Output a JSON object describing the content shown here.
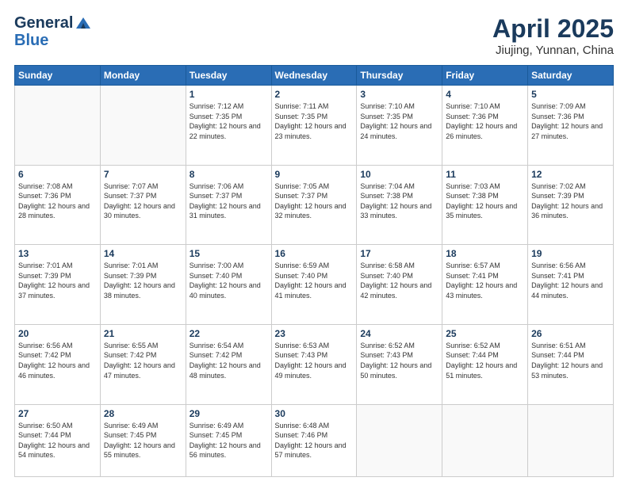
{
  "logo": {
    "general": "General",
    "blue": "Blue"
  },
  "header": {
    "month": "April 2025",
    "location": "Jiujing, Yunnan, China"
  },
  "weekdays": [
    "Sunday",
    "Monday",
    "Tuesday",
    "Wednesday",
    "Thursday",
    "Friday",
    "Saturday"
  ],
  "weeks": [
    [
      {
        "day": "",
        "info": ""
      },
      {
        "day": "",
        "info": ""
      },
      {
        "day": "1",
        "info": "Sunrise: 7:12 AM\nSunset: 7:35 PM\nDaylight: 12 hours and 22 minutes."
      },
      {
        "day": "2",
        "info": "Sunrise: 7:11 AM\nSunset: 7:35 PM\nDaylight: 12 hours and 23 minutes."
      },
      {
        "day": "3",
        "info": "Sunrise: 7:10 AM\nSunset: 7:35 PM\nDaylight: 12 hours and 24 minutes."
      },
      {
        "day": "4",
        "info": "Sunrise: 7:10 AM\nSunset: 7:36 PM\nDaylight: 12 hours and 26 minutes."
      },
      {
        "day": "5",
        "info": "Sunrise: 7:09 AM\nSunset: 7:36 PM\nDaylight: 12 hours and 27 minutes."
      }
    ],
    [
      {
        "day": "6",
        "info": "Sunrise: 7:08 AM\nSunset: 7:36 PM\nDaylight: 12 hours and 28 minutes."
      },
      {
        "day": "7",
        "info": "Sunrise: 7:07 AM\nSunset: 7:37 PM\nDaylight: 12 hours and 30 minutes."
      },
      {
        "day": "8",
        "info": "Sunrise: 7:06 AM\nSunset: 7:37 PM\nDaylight: 12 hours and 31 minutes."
      },
      {
        "day": "9",
        "info": "Sunrise: 7:05 AM\nSunset: 7:37 PM\nDaylight: 12 hours and 32 minutes."
      },
      {
        "day": "10",
        "info": "Sunrise: 7:04 AM\nSunset: 7:38 PM\nDaylight: 12 hours and 33 minutes."
      },
      {
        "day": "11",
        "info": "Sunrise: 7:03 AM\nSunset: 7:38 PM\nDaylight: 12 hours and 35 minutes."
      },
      {
        "day": "12",
        "info": "Sunrise: 7:02 AM\nSunset: 7:39 PM\nDaylight: 12 hours and 36 minutes."
      }
    ],
    [
      {
        "day": "13",
        "info": "Sunrise: 7:01 AM\nSunset: 7:39 PM\nDaylight: 12 hours and 37 minutes."
      },
      {
        "day": "14",
        "info": "Sunrise: 7:01 AM\nSunset: 7:39 PM\nDaylight: 12 hours and 38 minutes."
      },
      {
        "day": "15",
        "info": "Sunrise: 7:00 AM\nSunset: 7:40 PM\nDaylight: 12 hours and 40 minutes."
      },
      {
        "day": "16",
        "info": "Sunrise: 6:59 AM\nSunset: 7:40 PM\nDaylight: 12 hours and 41 minutes."
      },
      {
        "day": "17",
        "info": "Sunrise: 6:58 AM\nSunset: 7:40 PM\nDaylight: 12 hours and 42 minutes."
      },
      {
        "day": "18",
        "info": "Sunrise: 6:57 AM\nSunset: 7:41 PM\nDaylight: 12 hours and 43 minutes."
      },
      {
        "day": "19",
        "info": "Sunrise: 6:56 AM\nSunset: 7:41 PM\nDaylight: 12 hours and 44 minutes."
      }
    ],
    [
      {
        "day": "20",
        "info": "Sunrise: 6:56 AM\nSunset: 7:42 PM\nDaylight: 12 hours and 46 minutes."
      },
      {
        "day": "21",
        "info": "Sunrise: 6:55 AM\nSunset: 7:42 PM\nDaylight: 12 hours and 47 minutes."
      },
      {
        "day": "22",
        "info": "Sunrise: 6:54 AM\nSunset: 7:42 PM\nDaylight: 12 hours and 48 minutes."
      },
      {
        "day": "23",
        "info": "Sunrise: 6:53 AM\nSunset: 7:43 PM\nDaylight: 12 hours and 49 minutes."
      },
      {
        "day": "24",
        "info": "Sunrise: 6:52 AM\nSunset: 7:43 PM\nDaylight: 12 hours and 50 minutes."
      },
      {
        "day": "25",
        "info": "Sunrise: 6:52 AM\nSunset: 7:44 PM\nDaylight: 12 hours and 51 minutes."
      },
      {
        "day": "26",
        "info": "Sunrise: 6:51 AM\nSunset: 7:44 PM\nDaylight: 12 hours and 53 minutes."
      }
    ],
    [
      {
        "day": "27",
        "info": "Sunrise: 6:50 AM\nSunset: 7:44 PM\nDaylight: 12 hours and 54 minutes."
      },
      {
        "day": "28",
        "info": "Sunrise: 6:49 AM\nSunset: 7:45 PM\nDaylight: 12 hours and 55 minutes."
      },
      {
        "day": "29",
        "info": "Sunrise: 6:49 AM\nSunset: 7:45 PM\nDaylight: 12 hours and 56 minutes."
      },
      {
        "day": "30",
        "info": "Sunrise: 6:48 AM\nSunset: 7:46 PM\nDaylight: 12 hours and 57 minutes."
      },
      {
        "day": "",
        "info": ""
      },
      {
        "day": "",
        "info": ""
      },
      {
        "day": "",
        "info": ""
      }
    ]
  ]
}
